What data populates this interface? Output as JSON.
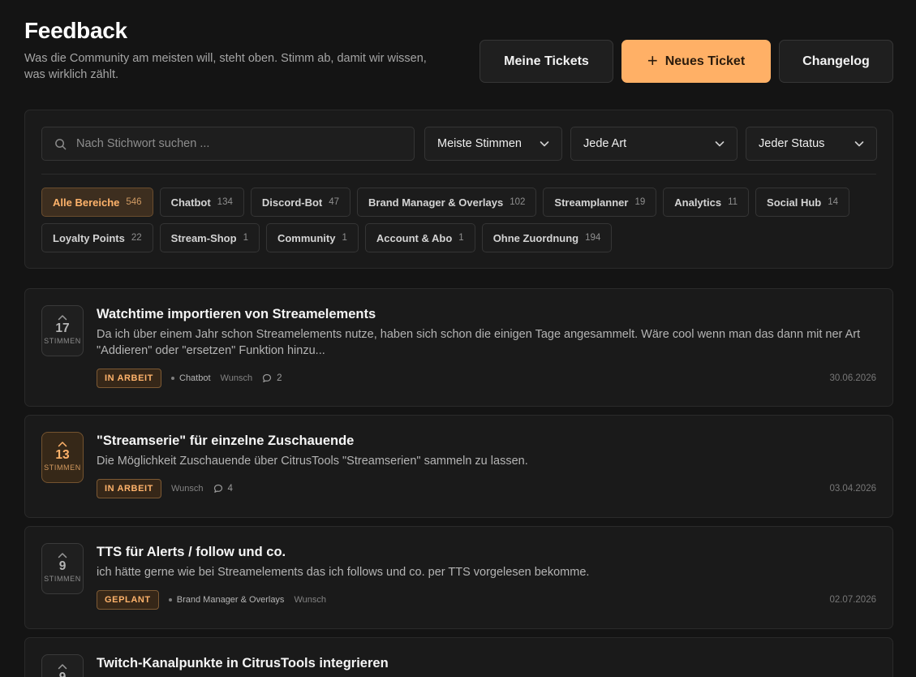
{
  "header": {
    "title": "Feedback",
    "subtitle": "Was die Community am meisten will, steht oben. Stimm ab, damit wir wissen, was wirklich zählt.",
    "buttons": {
      "my_tickets": "Meine Tickets",
      "new_ticket": "Neues Ticket",
      "changelog": "Changelog"
    }
  },
  "filters": {
    "search_placeholder": "Nach Stichwort suchen ...",
    "sort": "Meiste Stimmen",
    "type": "Jede Art",
    "status": "Jeder Status",
    "categories": [
      {
        "label": "Alle Bereiche",
        "count": "546",
        "active": true
      },
      {
        "label": "Chatbot",
        "count": "134"
      },
      {
        "label": "Discord-Bot",
        "count": "47"
      },
      {
        "label": "Brand Manager & Overlays",
        "count": "102"
      },
      {
        "label": "Streamplanner",
        "count": "19"
      },
      {
        "label": "Analytics",
        "count": "11"
      },
      {
        "label": "Social Hub",
        "count": "14"
      },
      {
        "label": "Loyalty Points",
        "count": "22"
      },
      {
        "label": "Stream-Shop",
        "count": "1"
      },
      {
        "label": "Community",
        "count": "1"
      },
      {
        "label": "Account & Abo",
        "count": "1"
      },
      {
        "label": "Ohne Zuordnung",
        "count": "194"
      }
    ]
  },
  "vote_label": "STIMMEN",
  "tickets": [
    {
      "votes": "17",
      "title": "Watchtime importieren von Streamelements",
      "description": "Da ich über einem Jahr schon Streamelements nutze, haben sich schon die einigen Tage angesammelt. Wäre cool wenn man das dann mit ner Art \"Addieren\" oder \"ersetzen\" Funktion hinzu...",
      "status": "IN ARBEIT",
      "category": "Chatbot",
      "kind": "Wunsch",
      "comments": "2",
      "date": "30.06.2026"
    },
    {
      "votes": "13",
      "voted": true,
      "title": "\"Streamserie\" für einzelne Zuschauende",
      "description": "Die Möglichkeit Zuschauende über CitrusTools \"Streamserien\" sammeln zu lassen.",
      "status": "IN ARBEIT",
      "kind": "Wunsch",
      "comments": "4",
      "date": "03.04.2026"
    },
    {
      "votes": "9",
      "title": "TTS für Alerts / follow und co.",
      "description": "ich hätte gerne wie bei Streamelements das ich follows und co. per TTS vorgelesen bekomme.",
      "status": "GEPLANT",
      "category": "Brand Manager & Overlays",
      "kind": "Wunsch",
      "date": "02.07.2026"
    },
    {
      "votes": "9",
      "title": "Twitch-Kanalpunkte in CitrusTools integrieren"
    }
  ]
}
